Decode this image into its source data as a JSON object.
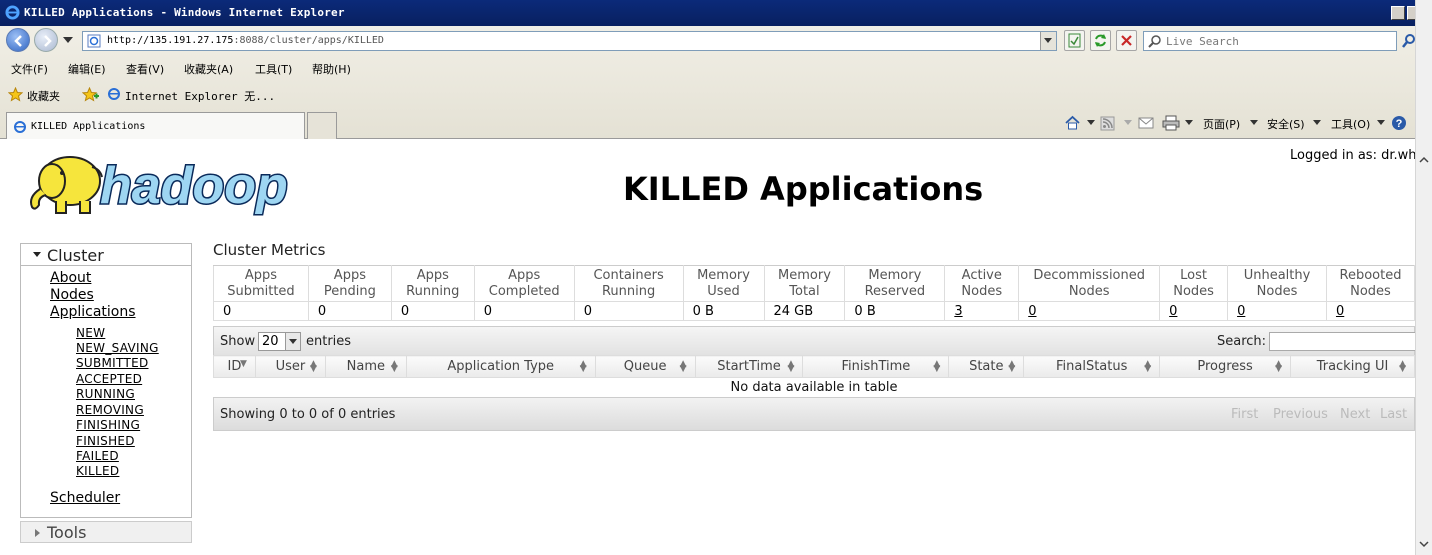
{
  "window": {
    "title": "KILLED Applications - Windows Internet Explorer"
  },
  "browser": {
    "url_host": "http://135.191.27.175",
    "url_path": ":8088/cluster/apps/KILLED",
    "search_placeholder": "Live Search",
    "menu": [
      "文件(F)",
      "编辑(E)",
      "查看(V)",
      "收藏夹(A)",
      "工具(T)",
      "帮助(H)"
    ],
    "favorites_label": "收藏夹",
    "favorites_item": "Internet Explorer 无...",
    "tab_label": "KILLED Applications",
    "cmd": [
      "页面(P)",
      "安全(S)",
      "工具(O)"
    ]
  },
  "page": {
    "logged_in": "Logged in as: dr.wh",
    "title": "KILLED Applications",
    "logo_text": "hadoop"
  },
  "sidebar": {
    "cluster_label": "Cluster",
    "links": [
      "About",
      "Nodes",
      "Applications"
    ],
    "states": [
      "NEW",
      "NEW_SAVING",
      "SUBMITTED",
      "ACCEPTED",
      "RUNNING",
      "REMOVING",
      "FINISHING",
      "FINISHED",
      "FAILED",
      "KILLED"
    ],
    "scheduler": "Scheduler",
    "tools_label": "Tools"
  },
  "metrics": {
    "title": "Cluster Metrics",
    "headers": [
      [
        "Apps",
        "Submitted"
      ],
      [
        "Apps",
        "Pending"
      ],
      [
        "Apps",
        "Running"
      ],
      [
        "Apps",
        "Completed"
      ],
      [
        "Containers",
        "Running"
      ],
      [
        "Memory",
        "Used"
      ],
      [
        "Memory",
        "Total"
      ],
      [
        "Memory",
        "Reserved"
      ],
      [
        "Active",
        "Nodes"
      ],
      [
        "Decommissioned",
        "Nodes"
      ],
      [
        "Lost",
        "Nodes"
      ],
      [
        "Unhealthy",
        "Nodes"
      ],
      [
        "Rebooted",
        "Nodes"
      ]
    ],
    "values": [
      "0",
      "0",
      "0",
      "0",
      "0",
      "0 B",
      "24 GB",
      "0 B",
      "3",
      "0",
      "0",
      "0",
      "0"
    ]
  },
  "apps_table": {
    "show_label": "Show",
    "page_size": "20",
    "entries_label": "entries",
    "search_label": "Search:",
    "columns": [
      "ID",
      "User",
      "Name",
      "Application Type",
      "Queue",
      "StartTime",
      "FinishTime",
      "State",
      "FinalStatus",
      "Progress",
      "Tracking UI"
    ],
    "empty_message": "No data available in table",
    "info": "Showing 0 to 0 of 0 entries",
    "pager": [
      "First",
      "Previous",
      "Next",
      "Last"
    ]
  }
}
